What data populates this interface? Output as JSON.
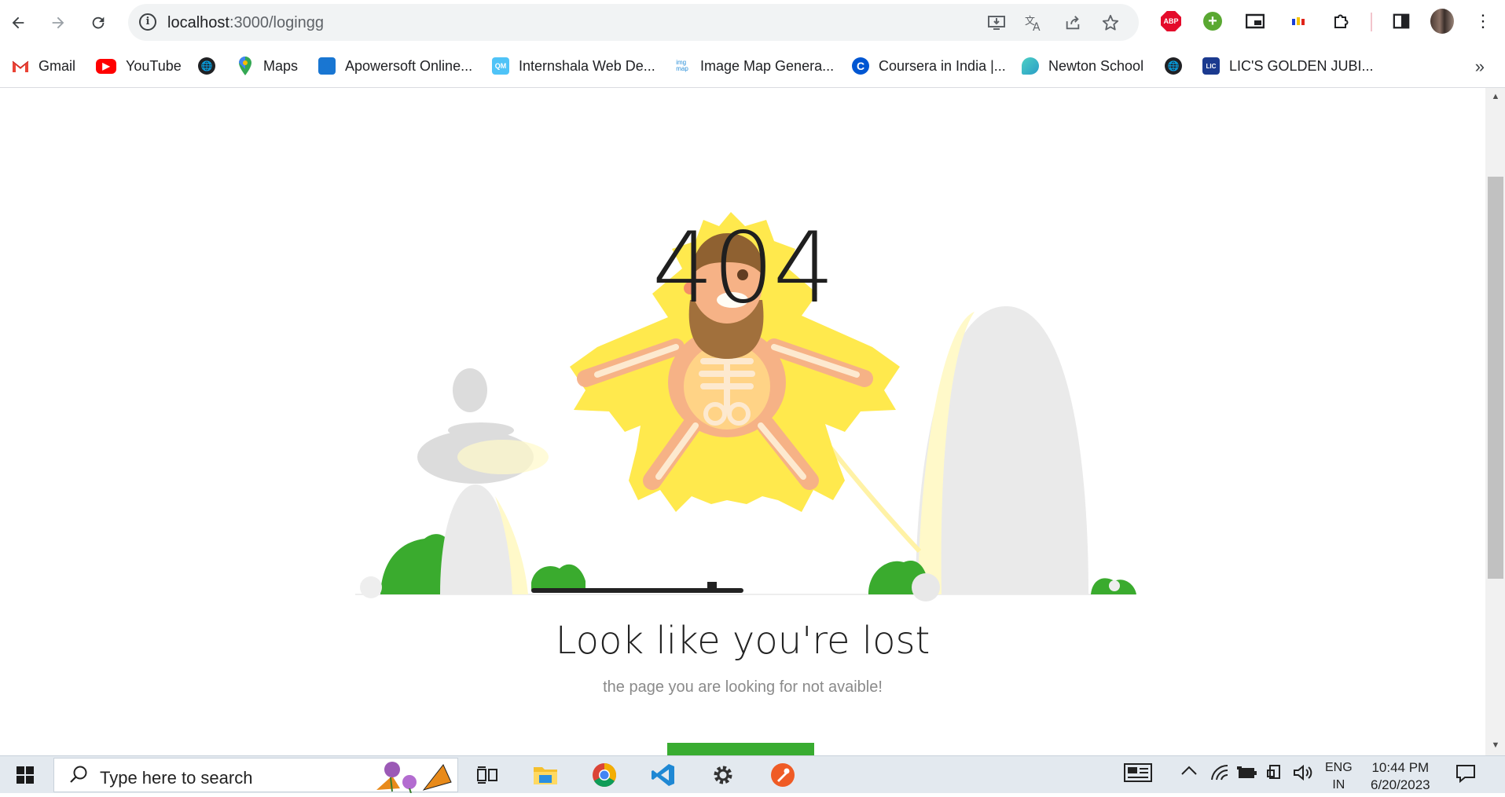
{
  "browser": {
    "url_host": "localhost",
    "url_path": ":3000/logingg",
    "bookmarks": [
      {
        "label": "Gmail",
        "icon": "gmail-icon"
      },
      {
        "label": "YouTube",
        "icon": "youtube-icon"
      },
      {
        "label": "",
        "icon": "globe-icon"
      },
      {
        "label": "Maps",
        "icon": "maps-icon"
      },
      {
        "label": "Apowersoft Online...",
        "icon": "apowersoft-icon"
      },
      {
        "label": "Internshala Web De...",
        "icon": "internshala-icon"
      },
      {
        "label": "Image Map Genera...",
        "icon": "imagemap-icon"
      },
      {
        "label": "Coursera in India |...",
        "icon": "coursera-icon"
      },
      {
        "label": "Newton School",
        "icon": "newton-icon"
      },
      {
        "label": "",
        "icon": "globe-icon"
      },
      {
        "label": "LIC'S GOLDEN JUBI...",
        "icon": "lic-icon"
      }
    ],
    "more_bookmarks": "»",
    "abp_label": "ABP"
  },
  "page": {
    "code": "404",
    "headline": "Look like you're lost",
    "subline": "the page you are looking for not avaible!",
    "button_label": ""
  },
  "taskbar": {
    "search_placeholder": "Type here to search",
    "lang_line1": "ENG",
    "lang_line2": "IN",
    "time": "10:44 PM",
    "date": "6/20/2023"
  },
  "colors": {
    "accent_green": "#39ac31",
    "glow_yellow": "#ffe94d",
    "stone_gray": "#e6e6e6"
  }
}
